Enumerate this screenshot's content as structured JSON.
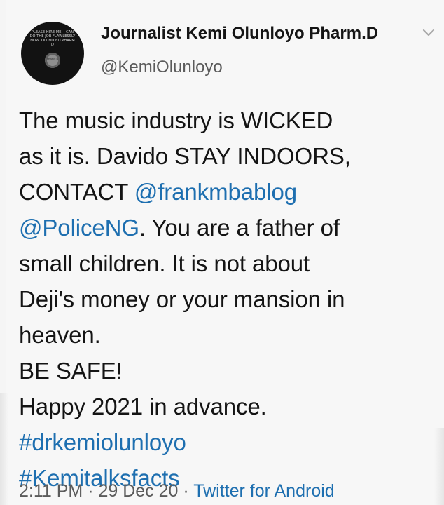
{
  "account": {
    "display_name": "Journalist Kemi Olunloyo Pharm.D",
    "handle": "@KemiOlunloyo",
    "avatar_text": "PLEASE HIRE ME. I CAN DO THE JOB FLAWLESSLY NOW. OLUNLOYO PHARM D"
  },
  "tweet": {
    "line_1": "The music industry is WICKED",
    "line_2": "as it is. Davido STAY INDOORS,",
    "line_3_prefix": "CONTACT ",
    "line_3_mention": "@frankmbablog",
    "line_4_mention": "@PoliceNG",
    "line_4_suffix": ". You are a father of",
    "line_5": "small children. It is not about",
    "line_6": "Deji's money or your mansion in",
    "line_7": "heaven.",
    "line_8": "BE SAFE!",
    "line_9": "Happy 2021 in advance.",
    "hashtag_1": "#drkemiolunloyo",
    "hashtag_2": "#Kemitalksfacts"
  },
  "meta": {
    "time": "2:11 PM",
    "separator_1": " · ",
    "date": "29 Dec 20",
    "separator_2": " · ",
    "source": "Twitter for Android"
  },
  "icons": {
    "chevron": "chevron-down-icon"
  },
  "colors": {
    "text": "#141414",
    "muted": "#5b5b5b",
    "link": "#1e6fb0",
    "background": "#f7f7f7"
  }
}
